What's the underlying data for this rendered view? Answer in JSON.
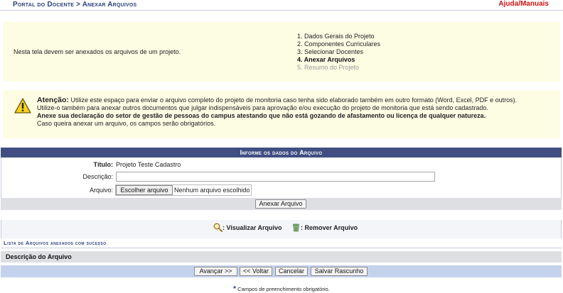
{
  "header": {
    "breadcrumb": "Portal do Docente > Anexar Arquivos",
    "help_link": "Ajuda/Manuais"
  },
  "intro": {
    "text": "Nesta tela devem ser anexados os arquivos de um projeto.",
    "steps": [
      {
        "label": "1. Dados Gerais do Projeto",
        "state": "done"
      },
      {
        "label": "2. Componentes Curriculares",
        "state": "done"
      },
      {
        "label": "3. Selecionar Docentes",
        "state": "done"
      },
      {
        "label": "4. Anexar Arquivos",
        "state": "current"
      },
      {
        "label": "5. Resumo do Projeto",
        "state": "todo"
      }
    ]
  },
  "warning": {
    "title": "Atenção:",
    "line1": "Utilize este espaço para enviar o arquivo completo do projeto de monitoria caso tenha sido elaborado também em outro formato (Word, Excel, PDF e outros).",
    "line2": "Utilize-o também para anexar outros documentos que julgar indispensáveis para aprovação e/ou execução do projeto de monitoria que está sendo cadastrado.",
    "line3": "Anexe sua declaração do setor de gestão de pessoas do campus atestando que não está gozando de afastamento ou licença de qualquer natureza.",
    "line4": "Caso queira anexar um arquivo, os campos serão obrigatórios."
  },
  "form": {
    "header": "Informe os dados do Arquivo",
    "title_label": "Título:",
    "title_value": "Projeto Teste Cadastro",
    "description_label": "Descrição:",
    "description_value": "",
    "file_label": "Arquivo:",
    "file_button": "Escolher arquivo",
    "file_status": "Nenhum arquivo escolhido",
    "submit": "Anexar Arquivo"
  },
  "legend": {
    "view": ": Visualizar Arquivo",
    "remove": ": Remover Arquivo"
  },
  "list": {
    "title": "Lista de Arquivos anexados com sucesso",
    "column": "Descrição do Arquivo"
  },
  "nav": {
    "next": "Avançar >>",
    "back": "<< Voltar",
    "cancel": "Cancelar",
    "save_draft": "Salvar Rascunho"
  },
  "footer": {
    "star": "*",
    "required_note": "Campos de preenchimento obrigatório."
  }
}
